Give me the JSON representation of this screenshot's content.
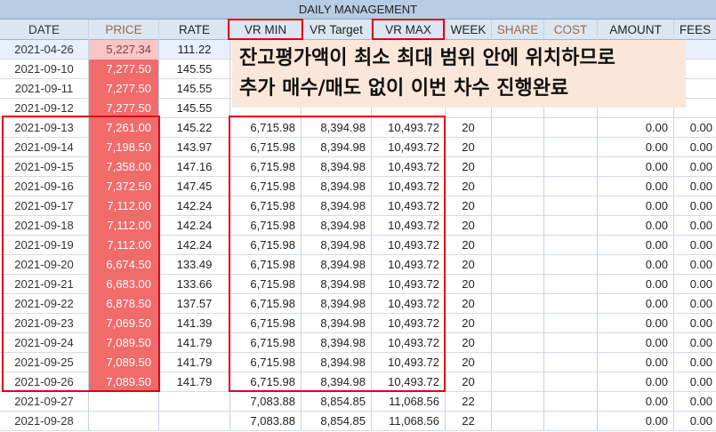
{
  "sheet": {
    "title": "DAILY MANAGEMENT"
  },
  "columns": {
    "date": "DATE",
    "price": "PRICE",
    "rate": "RATE",
    "vr_min": "VR MIN",
    "vr_target": "VR Target",
    "vr_max": "VR MAX",
    "week": "WEEK",
    "share": "SHARE",
    "cost": "COST",
    "amount": "AMOUNT",
    "fees": "FEES"
  },
  "overlay": {
    "line1": "잔고평가액이 최소 최대 범위 안에 위치하므로",
    "line2": "추가 매수/매도 없이 이번 차수 진행완료"
  },
  "colors": {
    "price_strong": "#f26b6b",
    "price_light": "#f8c6c6",
    "highlight_box": "#e0001b",
    "header_bg": "#dce6f1",
    "title_bg": "#b8cce4",
    "overlay_bg": "#fbe7d9"
  },
  "rows": [
    {
      "date": "2021-04-26",
      "price": "5,227.34",
      "rate": "111.22",
      "vr_min": "",
      "vr_target": "",
      "vr_max": "",
      "week": "",
      "amount": "",
      "fees": "",
      "price_level": "light"
    },
    {
      "date": "2021-09-10",
      "price": "7,277.50",
      "rate": "145.55",
      "vr_min": "",
      "vr_target": "",
      "vr_max": "",
      "week": "",
      "amount": "",
      "fees": "",
      "price_level": "strong"
    },
    {
      "date": "2021-09-11",
      "price": "7,277.50",
      "rate": "145.55",
      "vr_min": "",
      "vr_target": "",
      "vr_max": "",
      "week": "",
      "amount": "",
      "fees": "",
      "price_level": "strong"
    },
    {
      "date": "2021-09-12",
      "price": "7,277.50",
      "rate": "145.55",
      "vr_min": "",
      "vr_target": "",
      "vr_max": "",
      "week": "",
      "amount": "",
      "fees": "",
      "price_level": "strong"
    },
    {
      "date": "2021-09-13",
      "price": "7,261.00",
      "rate": "145.22",
      "vr_min": "6,715.98",
      "vr_target": "8,394.98",
      "vr_max": "10,493.72",
      "week": "20",
      "amount": "0.00",
      "fees": "0.00",
      "price_level": "strong"
    },
    {
      "date": "2021-09-14",
      "price": "7,198.50",
      "rate": "143.97",
      "vr_min": "6,715.98",
      "vr_target": "8,394.98",
      "vr_max": "10,493.72",
      "week": "20",
      "amount": "0.00",
      "fees": "0.00",
      "price_level": "strong"
    },
    {
      "date": "2021-09-15",
      "price": "7,358.00",
      "rate": "147.16",
      "vr_min": "6,715.98",
      "vr_target": "8,394.98",
      "vr_max": "10,493.72",
      "week": "20",
      "amount": "0.00",
      "fees": "0.00",
      "price_level": "strong"
    },
    {
      "date": "2021-09-16",
      "price": "7,372.50",
      "rate": "147.45",
      "vr_min": "6,715.98",
      "vr_target": "8,394.98",
      "vr_max": "10,493.72",
      "week": "20",
      "amount": "0.00",
      "fees": "0.00",
      "price_level": "strong"
    },
    {
      "date": "2021-09-17",
      "price": "7,112.00",
      "rate": "142.24",
      "vr_min": "6,715.98",
      "vr_target": "8,394.98",
      "vr_max": "10,493.72",
      "week": "20",
      "amount": "0.00",
      "fees": "0.00",
      "price_level": "strong"
    },
    {
      "date": "2021-09-18",
      "price": "7,112.00",
      "rate": "142.24",
      "vr_min": "6,715.98",
      "vr_target": "8,394.98",
      "vr_max": "10,493.72",
      "week": "20",
      "amount": "0.00",
      "fees": "0.00",
      "price_level": "strong"
    },
    {
      "date": "2021-09-19",
      "price": "7,112.00",
      "rate": "142.24",
      "vr_min": "6,715.98",
      "vr_target": "8,394.98",
      "vr_max": "10,493.72",
      "week": "20",
      "amount": "0.00",
      "fees": "0.00",
      "price_level": "strong"
    },
    {
      "date": "2021-09-20",
      "price": "6,674.50",
      "rate": "133.49",
      "vr_min": "6,715.98",
      "vr_target": "8,394.98",
      "vr_max": "10,493.72",
      "week": "20",
      "amount": "0.00",
      "fees": "0.00",
      "price_level": "strong"
    },
    {
      "date": "2021-09-21",
      "price": "6,683.00",
      "rate": "133.66",
      "vr_min": "6,715.98",
      "vr_target": "8,394.98",
      "vr_max": "10,493.72",
      "week": "20",
      "amount": "0.00",
      "fees": "0.00",
      "price_level": "strong"
    },
    {
      "date": "2021-09-22",
      "price": "6,878.50",
      "rate": "137.57",
      "vr_min": "6,715.98",
      "vr_target": "8,394.98",
      "vr_max": "10,493.72",
      "week": "20",
      "amount": "0.00",
      "fees": "0.00",
      "price_level": "strong"
    },
    {
      "date": "2021-09-23",
      "price": "7,069.50",
      "rate": "141.39",
      "vr_min": "6,715.98",
      "vr_target": "8,394.98",
      "vr_max": "10,493.72",
      "week": "20",
      "amount": "0.00",
      "fees": "0.00",
      "price_level": "strong"
    },
    {
      "date": "2021-09-24",
      "price": "7,089.50",
      "rate": "141.79",
      "vr_min": "6,715.98",
      "vr_target": "8,394.98",
      "vr_max": "10,493.72",
      "week": "20",
      "amount": "0.00",
      "fees": "0.00",
      "price_level": "strong"
    },
    {
      "date": "2021-09-25",
      "price": "7,089.50",
      "rate": "141.79",
      "vr_min": "6,715.98",
      "vr_target": "8,394.98",
      "vr_max": "10,493.72",
      "week": "20",
      "amount": "0.00",
      "fees": "0.00",
      "price_level": "strong"
    },
    {
      "date": "2021-09-26",
      "price": "7,089.50",
      "rate": "141.79",
      "vr_min": "6,715.98",
      "vr_target": "8,394.98",
      "vr_max": "10,493.72",
      "week": "20",
      "amount": "0.00",
      "fees": "0.00",
      "price_level": "strong"
    },
    {
      "date": "2021-09-27",
      "price": "",
      "rate": "",
      "vr_min": "7,083.88",
      "vr_target": "8,854.85",
      "vr_max": "11,068.56",
      "week": "22",
      "amount": "0.00",
      "fees": "0.00",
      "price_level": "none"
    },
    {
      "date": "2021-09-28",
      "price": "",
      "rate": "",
      "vr_min": "7,083.88",
      "vr_target": "8,854.85",
      "vr_max": "11,068.56",
      "week": "22",
      "amount": "0.00",
      "fees": "0.00",
      "price_level": "none"
    }
  ]
}
